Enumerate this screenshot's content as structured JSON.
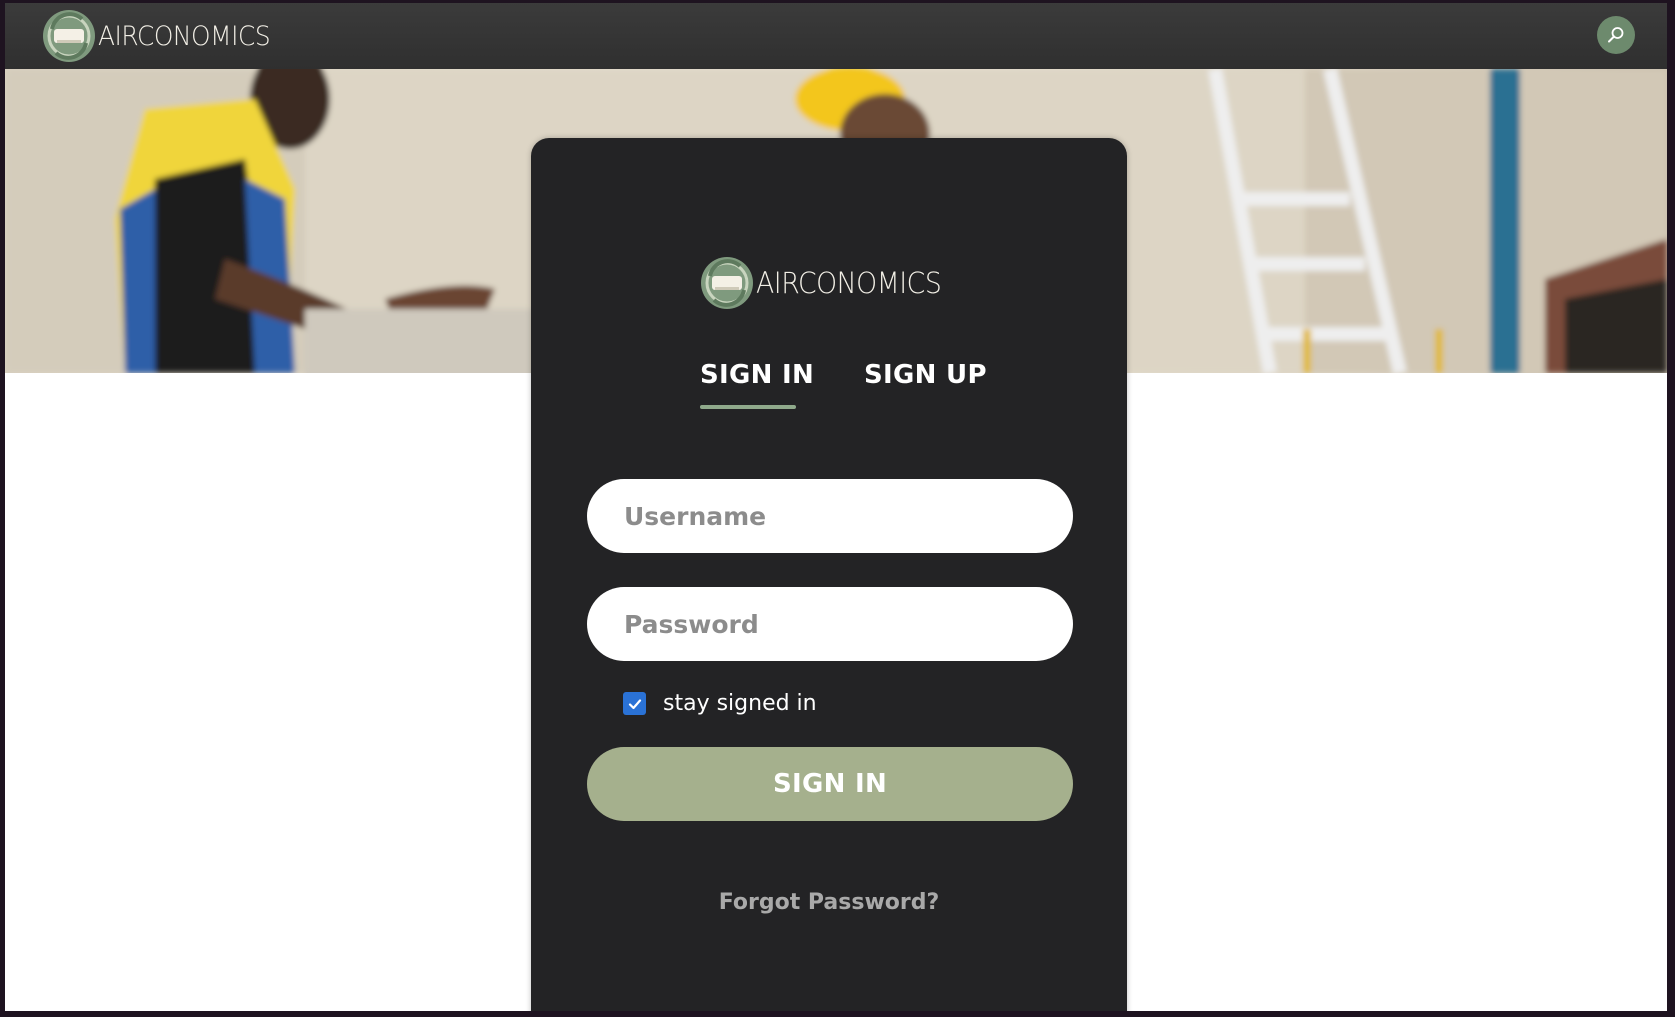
{
  "header": {
    "brand_name": "AIRCONOMICS",
    "logo_icon": "leaf-circle-logo-icon",
    "search_icon": "search-icon"
  },
  "hero": {
    "description_icon": "hvac-technicians-photo"
  },
  "login_card": {
    "brand_name": "AIRCONOMICS",
    "tabs": [
      {
        "label": "SIGN IN",
        "active": true
      },
      {
        "label": "SIGN UP",
        "active": false
      }
    ],
    "username_placeholder": "Username",
    "username_value": "",
    "password_placeholder": "Password",
    "password_value": "",
    "stay_signed_in_label": "stay signed in",
    "stay_signed_in_checked": true,
    "submit_label": "SIGN IN",
    "forgot_label": "Forgot Password?"
  },
  "colors": {
    "topbar": "#333333",
    "card": "#232325",
    "accent_green": "#8fa98b",
    "button_green": "#a5b08d",
    "checkbox_blue": "#2a72d6",
    "search_button": "#6d8a6d"
  }
}
